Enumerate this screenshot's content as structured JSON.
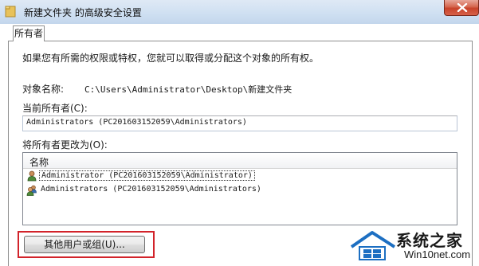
{
  "window": {
    "title": "新建文件夹 的高级安全设置",
    "icon": "folder-icon",
    "close_icon": "close-icon"
  },
  "tabs": [
    {
      "label": "所有者",
      "selected": true
    }
  ],
  "content": {
    "intro": "如果您有所需的权限或特权，您就可以取得或分配这个对象的所有权。",
    "object_name_label": "对象名称:",
    "object_name_value": "C:\\Users\\Administrator\\Desktop\\新建文件夹",
    "current_owner_label": "当前所有者(C):",
    "current_owner_value": "Administrators (PC201603152059\\Administrators)",
    "change_owner_label": "将所有者更改为(O):",
    "list": {
      "column_header": "名称",
      "items": [
        {
          "label": "Administrator (PC201603152059\\Administrator)",
          "icon": "user-icon",
          "selected": true
        },
        {
          "label": "Administrators (PC201603152059\\Administrators)",
          "icon": "group-icon",
          "selected": false
        }
      ]
    },
    "other_users_button": "其他用户或组(U)..."
  },
  "watermark": {
    "title": "系统之家",
    "url": "Win10net.com"
  },
  "colors": {
    "highlight_border": "#d2232a",
    "titlebar": "#cfe0f2",
    "close_button": "#c8432a"
  }
}
